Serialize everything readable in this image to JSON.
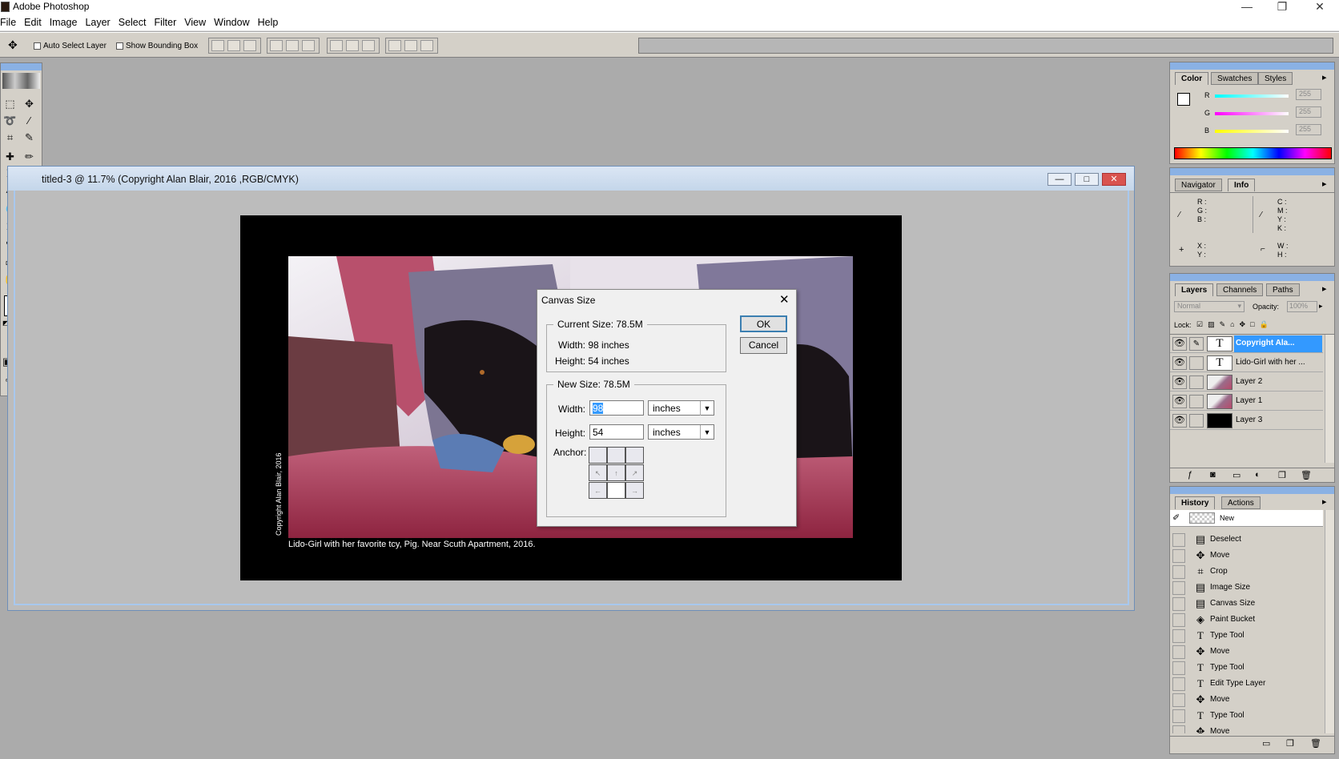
{
  "app": {
    "title": "Adobe Photoshop"
  },
  "menu": [
    "File",
    "Edit",
    "Image",
    "Layer",
    "Select",
    "Filter",
    "View",
    "Window",
    "Help"
  ],
  "options": {
    "auto_select": "Auto Select Layer",
    "bounding_box": "Show Bounding Box"
  },
  "document": {
    "title": "titled-3 @ 11.7% (Copyright Alan Blair, 2016 ,RGB/CMYK)",
    "caption": "Lido-Girl with her favorite tcy, Pig. Near Scuth Apartment, 2016.",
    "vertical_copyright": "Copyright Alan Blair, 2016"
  },
  "dialog": {
    "title": "Canvas Size",
    "current_size": "Current Size:  78.5M",
    "current_width": "Width:  98 inches",
    "current_height": "Height:  54 inches",
    "new_size": "New Size:  78.5M",
    "width_label": "Width:",
    "width_value": "98",
    "width_unit": "inches",
    "height_label": "Height:",
    "height_value": "54",
    "height_unit": "inches",
    "anchor_label": "Anchor:",
    "ok": "OK",
    "cancel": "Cancel"
  },
  "color_panel": {
    "tabs": [
      "Color",
      "Swatches",
      "Styles"
    ],
    "r_label": "R",
    "g_label": "G",
    "b_label": "B",
    "r": "255",
    "g": "255",
    "b": "255"
  },
  "info_panel": {
    "tabs": [
      "Navigator",
      "Info"
    ],
    "rgb": "R :\nG :\nB :",
    "cmyk": "C :\nM :\nY :\nK :",
    "xy": "X :\nY :",
    "wh": "W :\nH :"
  },
  "layers_panel": {
    "tabs": [
      "Layers",
      "Channels",
      "Paths"
    ],
    "blend_mode": "Normal",
    "opacity_label": "Opacity:",
    "opacity": "100%",
    "lock_label": "Lock:",
    "layers": [
      {
        "name": "Copyright Ala...",
        "type": "T",
        "selected": true
      },
      {
        "name": "Lido-Girl with her ...",
        "type": "T",
        "selected": false
      },
      {
        "name": "Layer 2",
        "type": "img",
        "selected": false
      },
      {
        "name": "Layer 1",
        "type": "img",
        "selected": false
      },
      {
        "name": "Layer 3",
        "type": "black",
        "selected": false
      }
    ]
  },
  "history_panel": {
    "tabs": [
      "History",
      "Actions"
    ],
    "snapshot": "New",
    "items": [
      "Deselect",
      "Move",
      "Crop",
      "Image Size",
      "Canvas Size",
      "Paint Bucket",
      "Type Tool",
      "Move",
      "Type Tool",
      "Edit Type Layer",
      "Move",
      "Type Tool",
      "Move"
    ]
  },
  "colors": {
    "accent": "#3399ff",
    "title_blue": "#8ab1e4"
  }
}
